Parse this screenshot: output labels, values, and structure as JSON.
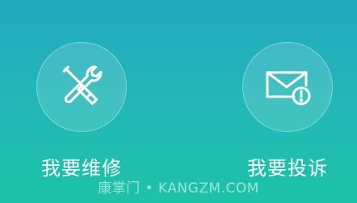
{
  "actions": [
    {
      "label": "我要维修",
      "icon": "wrench-screwdriver-icon"
    },
    {
      "label": "我要投诉",
      "icon": "envelope-alert-icon"
    }
  ],
  "watermark": "康掌门 • KANGZM.COM",
  "colors": {
    "gradient_top": "#22a8c0",
    "gradient_bottom": "#1dc3a8",
    "icon_stroke": "#ffffff"
  }
}
